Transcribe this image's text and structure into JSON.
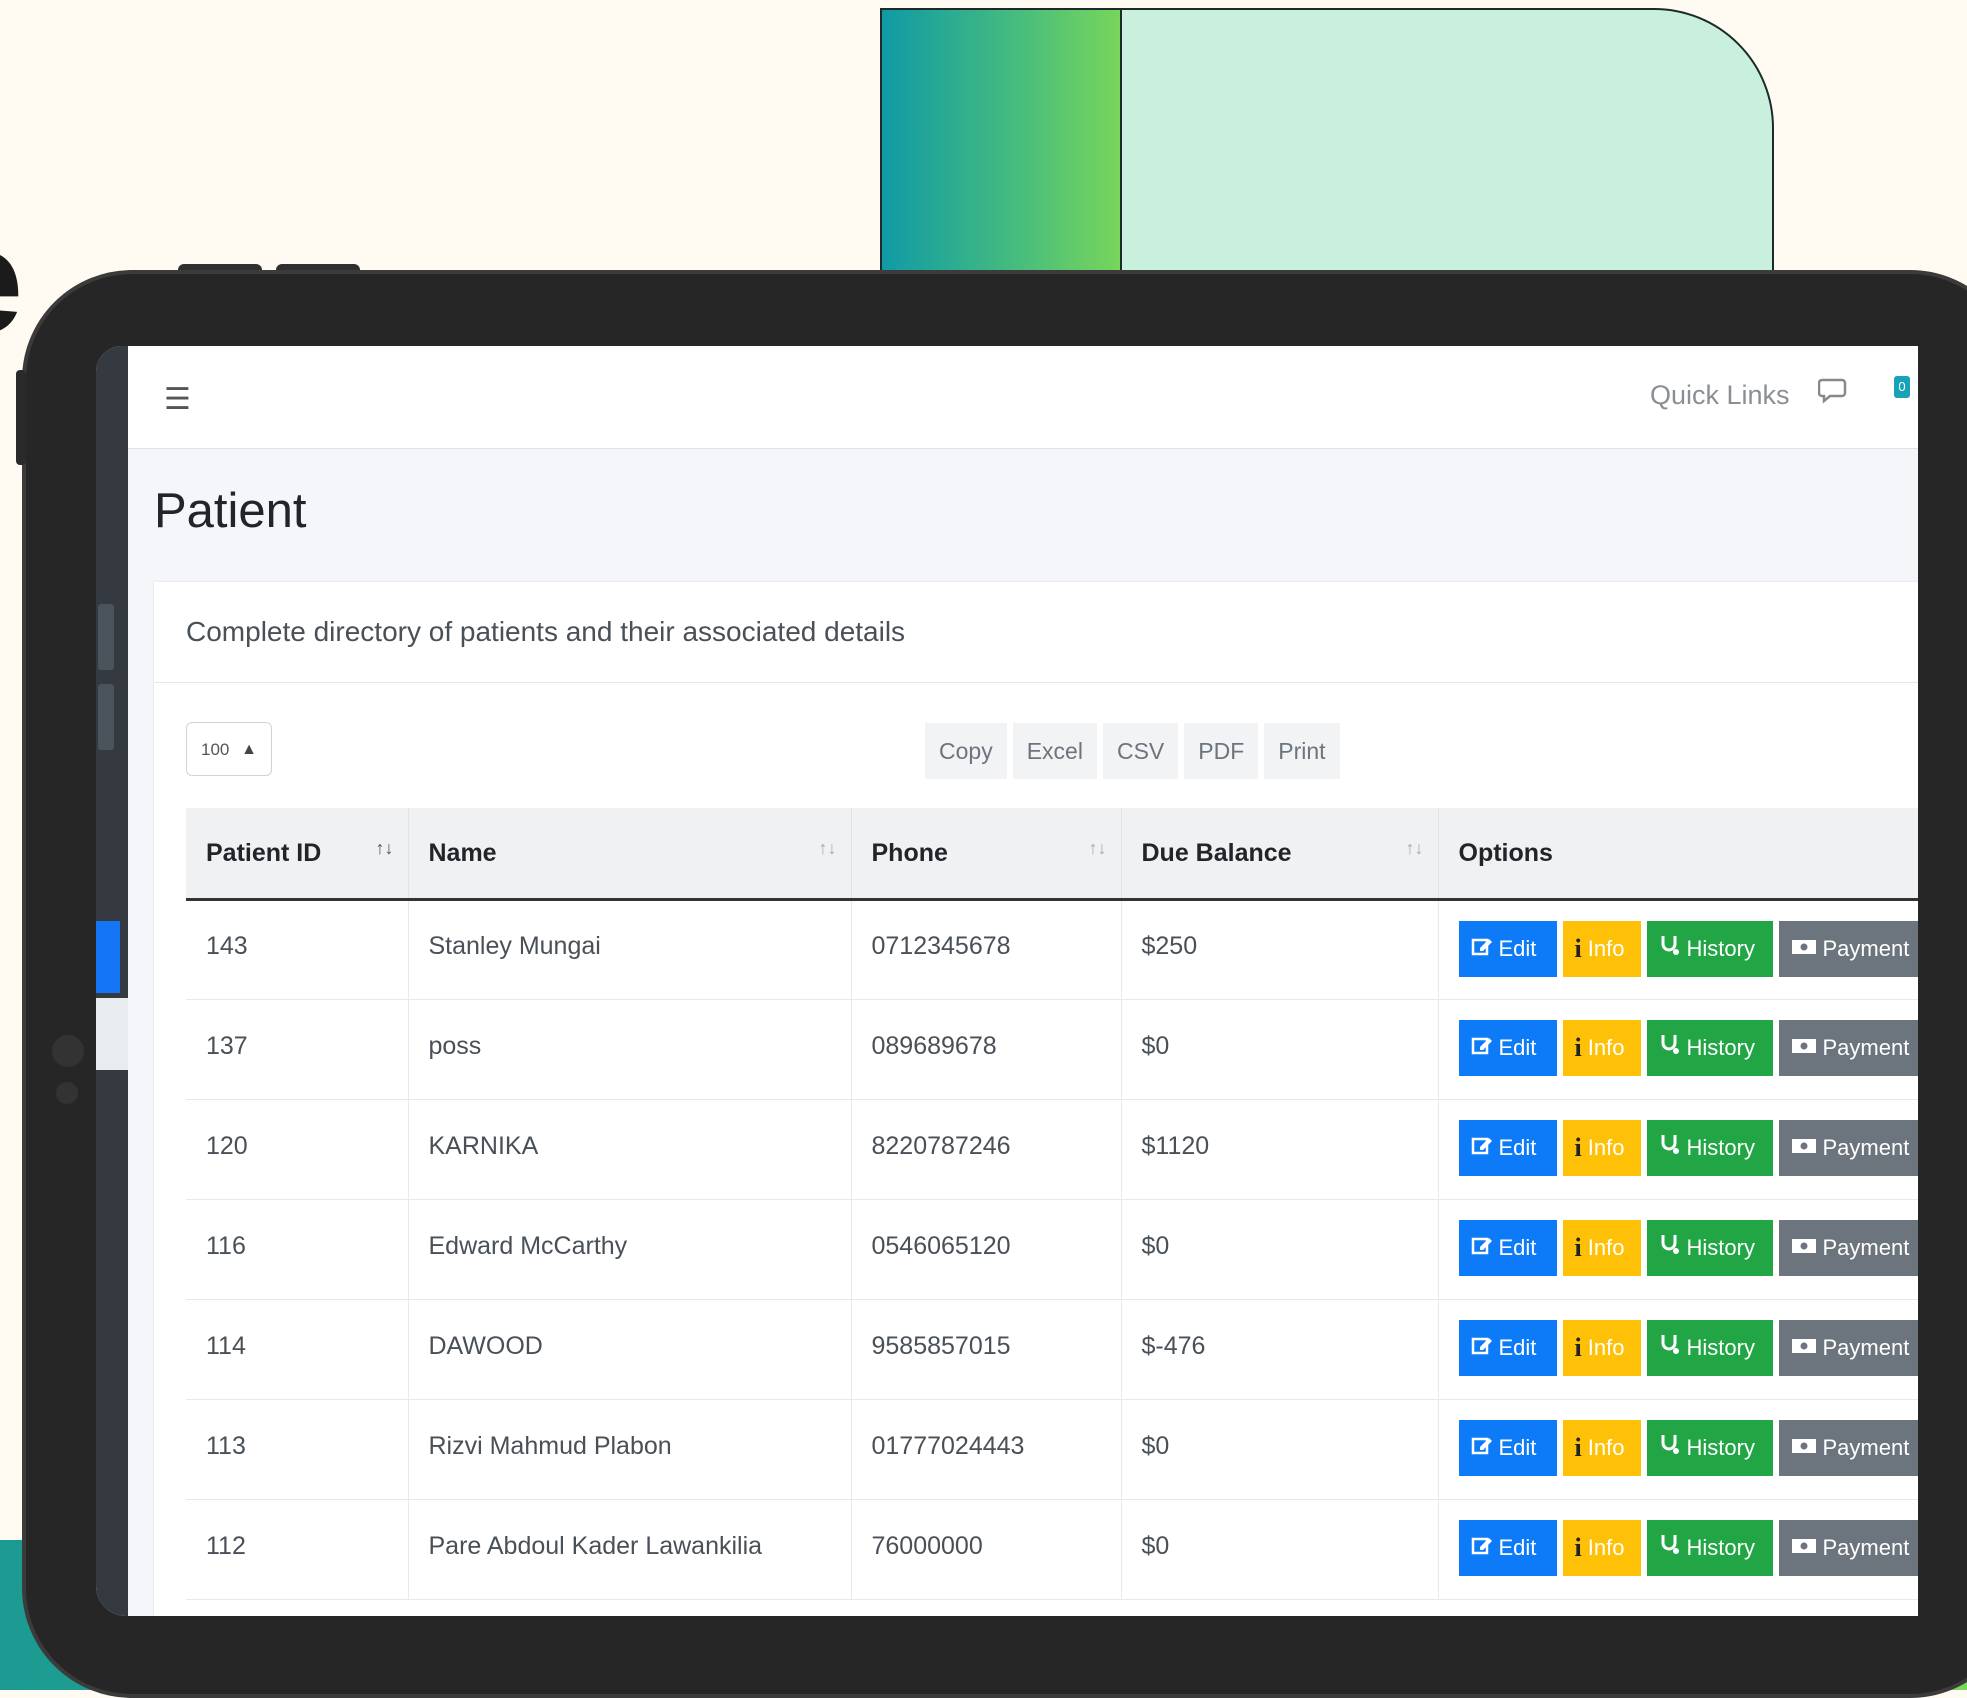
{
  "topbar": {
    "menu_icon": "hamburger-icon",
    "quick_links": "Quick Links",
    "chat_icon": "chat-bubble-icon",
    "chat_badge": "0"
  },
  "page": {
    "title": "Patient",
    "description": "Complete directory of patients and their associated details"
  },
  "controls": {
    "page_length": "100",
    "export_buttons": [
      "Copy",
      "Excel",
      "CSV",
      "PDF",
      "Print"
    ]
  },
  "table": {
    "columns": [
      "Patient ID",
      "Name",
      "Phone",
      "Due Balance",
      "Options"
    ],
    "rows": [
      {
        "id": "143",
        "name": "Stanley Mungai",
        "phone": "0712345678",
        "due": "$250"
      },
      {
        "id": "137",
        "name": "poss",
        "phone": "089689678",
        "due": "$0"
      },
      {
        "id": "120",
        "name": "KARNIKA",
        "phone": "8220787246",
        "due": "$1120"
      },
      {
        "id": "116",
        "name": "Edward McCarthy",
        "phone": "0546065120",
        "due": "$0"
      },
      {
        "id": "114",
        "name": "DAWOOD",
        "phone": "9585857015",
        "due": "$-476"
      },
      {
        "id": "113",
        "name": "Rizvi Mahmud Plabon",
        "phone": "01777024443",
        "due": "$0"
      },
      {
        "id": "112",
        "name": "Pare Abdoul Kader Lawankilia",
        "phone": "76000000",
        "due": "$0"
      }
    ],
    "option_labels": {
      "edit": "Edit",
      "info": "Info",
      "history": "History",
      "payment": "Payment"
    }
  },
  "colors": {
    "edit": "#0d7bf7",
    "info": "#ffc107",
    "history": "#21a545",
    "payment": "#6c757d"
  }
}
